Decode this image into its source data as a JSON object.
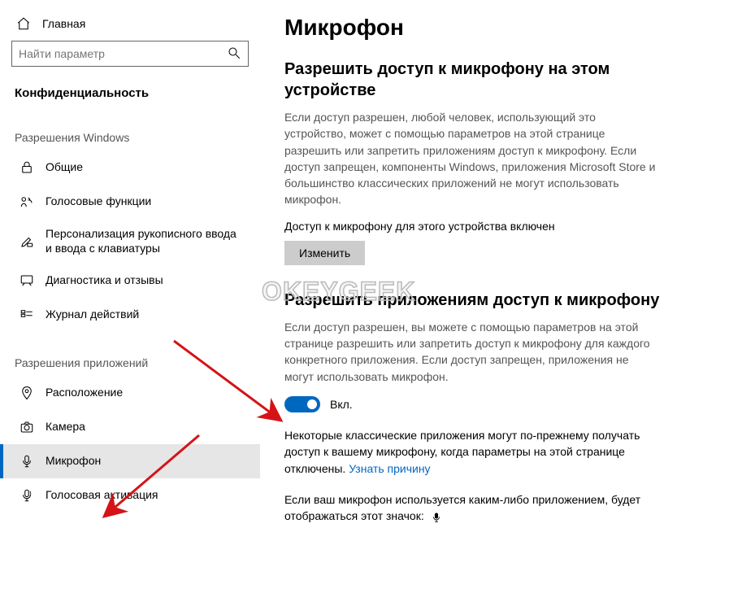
{
  "home_label": "Главная",
  "search_placeholder": "Найти параметр",
  "privacy_header": "Конфиденциальность",
  "section_win": "Разрешения Windows",
  "nav_win": [
    {
      "label": "Общие"
    },
    {
      "label": "Голосовые функции"
    },
    {
      "label": "Персонализация рукописного ввода и ввода с клавиатуры"
    },
    {
      "label": "Диагностика и отзывы"
    },
    {
      "label": "Журнал действий"
    }
  ],
  "section_app": "Разрешения приложений",
  "nav_app": [
    {
      "label": "Расположение"
    },
    {
      "label": "Камера"
    },
    {
      "label": "Микрофон"
    },
    {
      "label": "Голосовая активация"
    }
  ],
  "page_title": "Микрофон",
  "sec1_title": "Разрешить доступ к микрофону на этом устройстве",
  "sec1_body": "Если доступ разрешен, любой человек, использующий это устройство, может с помощью параметров на этой странице разрешить или запретить приложениям доступ к микрофону. Если доступ запрещен, компоненты Windows, приложения Microsoft Store и большинство классических приложений не могут использовать микрофон.",
  "sec1_status": "Доступ к микрофону для этого устройства включен",
  "change_btn": "Изменить",
  "sec2_title": "Разрешить приложениям доступ к микрофону",
  "sec2_body": "Если доступ разрешен, вы можете с помощью параметров на этой странице разрешить или запретить доступ к микрофону для каждого конкретного приложения. Если доступ запрещен, приложения не могут использовать микрофон.",
  "toggle_label": "Вкл.",
  "note_text_a": "Некоторые классические приложения могут по-прежнему получать доступ к вашему микрофону, когда параметры на этой странице отключены. ",
  "note_link": "Узнать причину",
  "footer_text": "Если ваш микрофон используется каким-либо приложением, будет отображаться этот значок:",
  "watermark": "OKEYGEEK"
}
